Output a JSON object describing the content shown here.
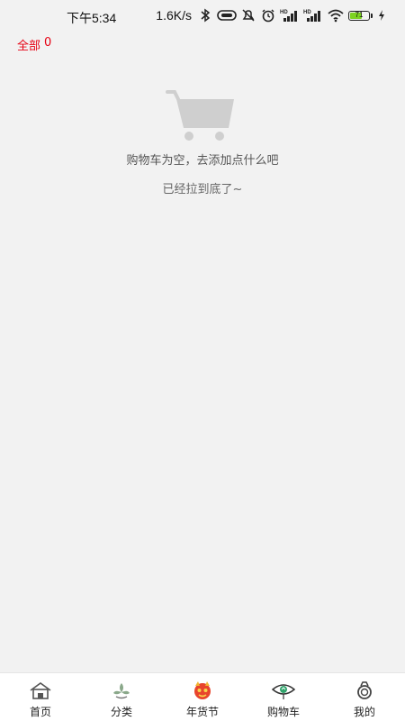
{
  "status_bar": {
    "time": "下午5:34",
    "net_speed": "1.6K/s",
    "battery": "71",
    "battery_level": 0.71,
    "battery_color": "#7dd321",
    "icons": [
      "bluetooth-icon",
      "hd-volte-icon",
      "mute-icon",
      "alarm-icon",
      "hd-signal-icon",
      "hd-signal-icon",
      "wifi-icon",
      "battery-icon",
      "charging-icon"
    ]
  },
  "filter": {
    "label": "全部",
    "count": "0",
    "color": "#e60012"
  },
  "empty_state": {
    "icon": "cart-icon",
    "message": "购物车为空，去添加点什么吧",
    "footer": "已经拉到底了~"
  },
  "tabs": [
    {
      "label": "首页",
      "icon": "home-icon"
    },
    {
      "label": "分类",
      "icon": "category-icon"
    },
    {
      "label": "年货节",
      "icon": "festival-icon"
    },
    {
      "label": "购物车",
      "icon": "cart-eye-icon"
    },
    {
      "label": "我的",
      "icon": "profile-icon"
    }
  ]
}
